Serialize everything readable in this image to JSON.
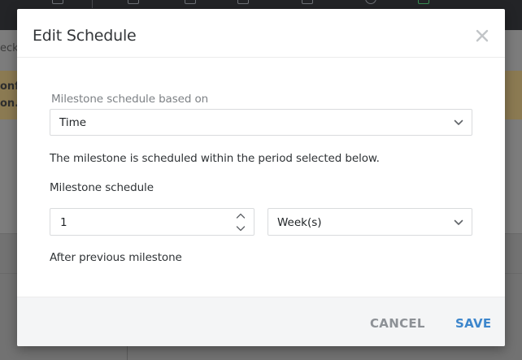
{
  "background": {
    "breadcrumb_fragment": "eck",
    "banner_line1": "onf",
    "banner_line2": "on."
  },
  "modal": {
    "title": "Edit Schedule",
    "close_icon": "close-icon",
    "based_on_label": "Milestone schedule based on",
    "based_on_value": "Time",
    "description": "The milestone is scheduled within the period selected below.",
    "schedule_label": "Milestone schedule",
    "schedule_amount": "1",
    "schedule_unit": "Week(s)",
    "after_text": "After previous milestone"
  },
  "footer": {
    "cancel_label": "CANCEL",
    "save_label": "SAVE"
  },
  "colors": {
    "accent": "#3d86cc",
    "cancel": "#8d9196",
    "topbar": "#232427"
  }
}
